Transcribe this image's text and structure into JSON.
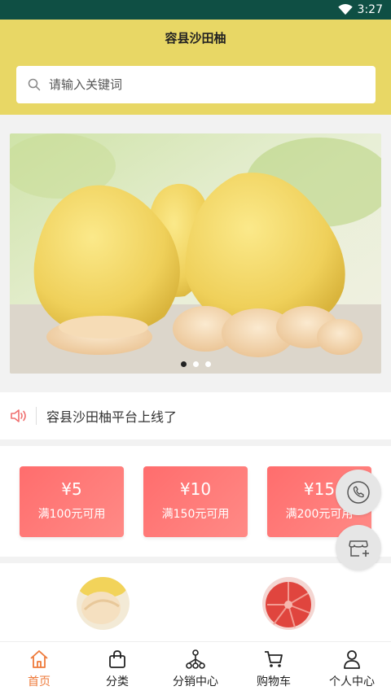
{
  "status_bar": {
    "time": "3:27"
  },
  "header": {
    "title": "容县沙田柚"
  },
  "search": {
    "placeholder": "请输入关键词"
  },
  "banner": {
    "dot_count": 3,
    "active_dot": 0
  },
  "notice": {
    "text": "容县沙田柚平台上线了"
  },
  "coupons": [
    {
      "amount": "¥5",
      "condition": "满100元可用"
    },
    {
      "amount": "¥10",
      "condition": "满150元可用"
    },
    {
      "amount": "¥15",
      "condition": "满200元可用"
    }
  ],
  "colors": {
    "header_bg": "#e8d765",
    "coupon": "#ff7777",
    "active_tab": "#ee7a3a",
    "status_bar": "#0f4f44"
  },
  "tabs": [
    {
      "label": "首页",
      "icon": "home-icon",
      "active": true
    },
    {
      "label": "分类",
      "icon": "bag-icon",
      "active": false
    },
    {
      "label": "分销中心",
      "icon": "network-icon",
      "active": false
    },
    {
      "label": "购物车",
      "icon": "cart-icon",
      "active": false
    },
    {
      "label": "个人中心",
      "icon": "user-icon",
      "active": false
    }
  ]
}
